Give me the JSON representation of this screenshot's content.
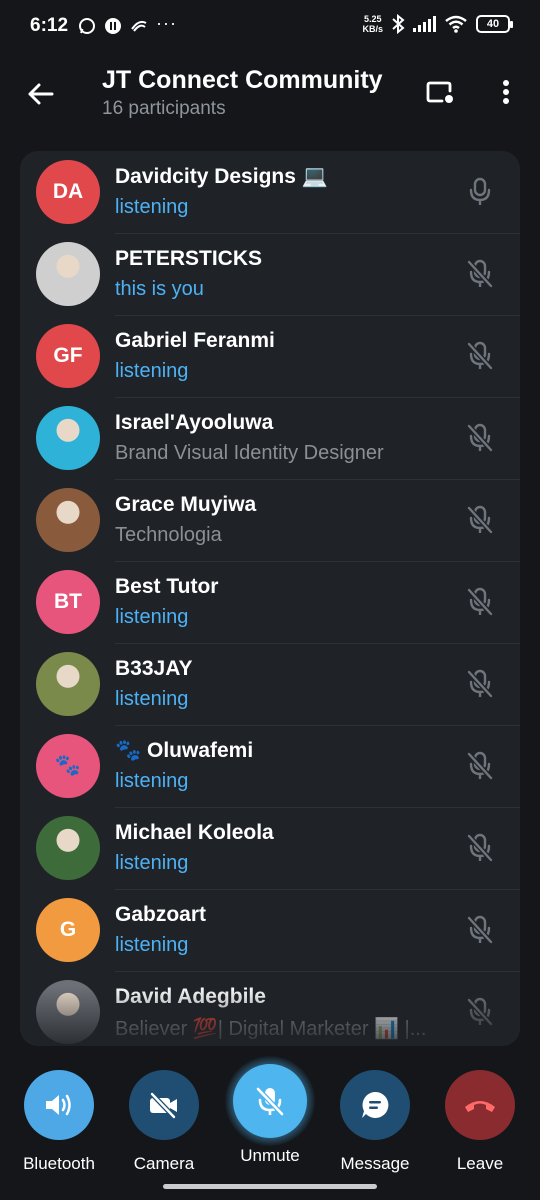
{
  "status_bar": {
    "time": "6:12",
    "net_speed_value": "5.25",
    "net_speed_unit": "KB/s",
    "battery": "40"
  },
  "header": {
    "title": "JT Connect Community",
    "subtitle": "16 participants"
  },
  "participants": [
    {
      "name": "Davidcity Designs 💻",
      "status": "listening",
      "status_color": "blue",
      "avatar_initials": "DA",
      "avatar_color": "#e0484c",
      "mic": "mic-icon"
    },
    {
      "name": "PETERSTICKS",
      "status": "this is you",
      "status_color": "blue",
      "avatar_initials": "",
      "avatar_color": "#cfcfcf",
      "mic": "mic-muted-icon"
    },
    {
      "name": "Gabriel Feranmi",
      "status": "listening",
      "status_color": "blue",
      "avatar_initials": "GF",
      "avatar_color": "#e0484c",
      "mic": "mic-muted-icon"
    },
    {
      "name": "Israel'Ayooluwa",
      "status": "Brand Visual Identity Designer",
      "status_color": "grey",
      "avatar_initials": "",
      "avatar_color": "#2fb2d8",
      "mic": "mic-muted-icon"
    },
    {
      "name": "Grace Muyiwa",
      "status": "Technologia",
      "status_color": "grey",
      "avatar_initials": "",
      "avatar_color": "#8a5a3c",
      "mic": "mic-muted-icon"
    },
    {
      "name": "Best Tutor",
      "status": "listening",
      "status_color": "blue",
      "avatar_initials": "BT",
      "avatar_color": "#e8557c",
      "mic": "mic-muted-icon"
    },
    {
      "name": "B33JAY",
      "status": "listening",
      "status_color": "blue",
      "avatar_initials": "",
      "avatar_color": "#7a8a4a",
      "mic": "mic-muted-icon"
    },
    {
      "name": "🐾 Oluwafemi",
      "status": "listening",
      "status_color": "blue",
      "avatar_initials": "🐾",
      "avatar_color": "#e8557c",
      "mic": "mic-muted-icon"
    },
    {
      "name": "Michael Koleola",
      "status": "listening",
      "status_color": "blue",
      "avatar_initials": "",
      "avatar_color": "#3d6b3a",
      "mic": "mic-muted-icon"
    },
    {
      "name": "Gabzoart",
      "status": "listening",
      "status_color": "blue",
      "avatar_initials": "G",
      "avatar_color": "#f29a3f",
      "mic": "mic-muted-icon"
    },
    {
      "name": "David Adegbile",
      "status": "Believer 💯| Digital Marketer 📊 |...",
      "status_color": "grey",
      "avatar_initials": "",
      "avatar_color": "#6d7076",
      "mic": "mic-muted-icon"
    }
  ],
  "controls": {
    "bluetooth": "Bluetooth",
    "camera": "Camera",
    "unmute": "Unmute",
    "message": "Message",
    "leave": "Leave"
  },
  "colors": {
    "accent_blue": "#4db2f5",
    "unmute_blue": "#4eb5ef",
    "bluetooth_blue": "#4ea8e6",
    "dark_blue": "#1f4e72",
    "leave_red": "#8a2b2f",
    "background": "#141619",
    "card": "#1f2328"
  }
}
